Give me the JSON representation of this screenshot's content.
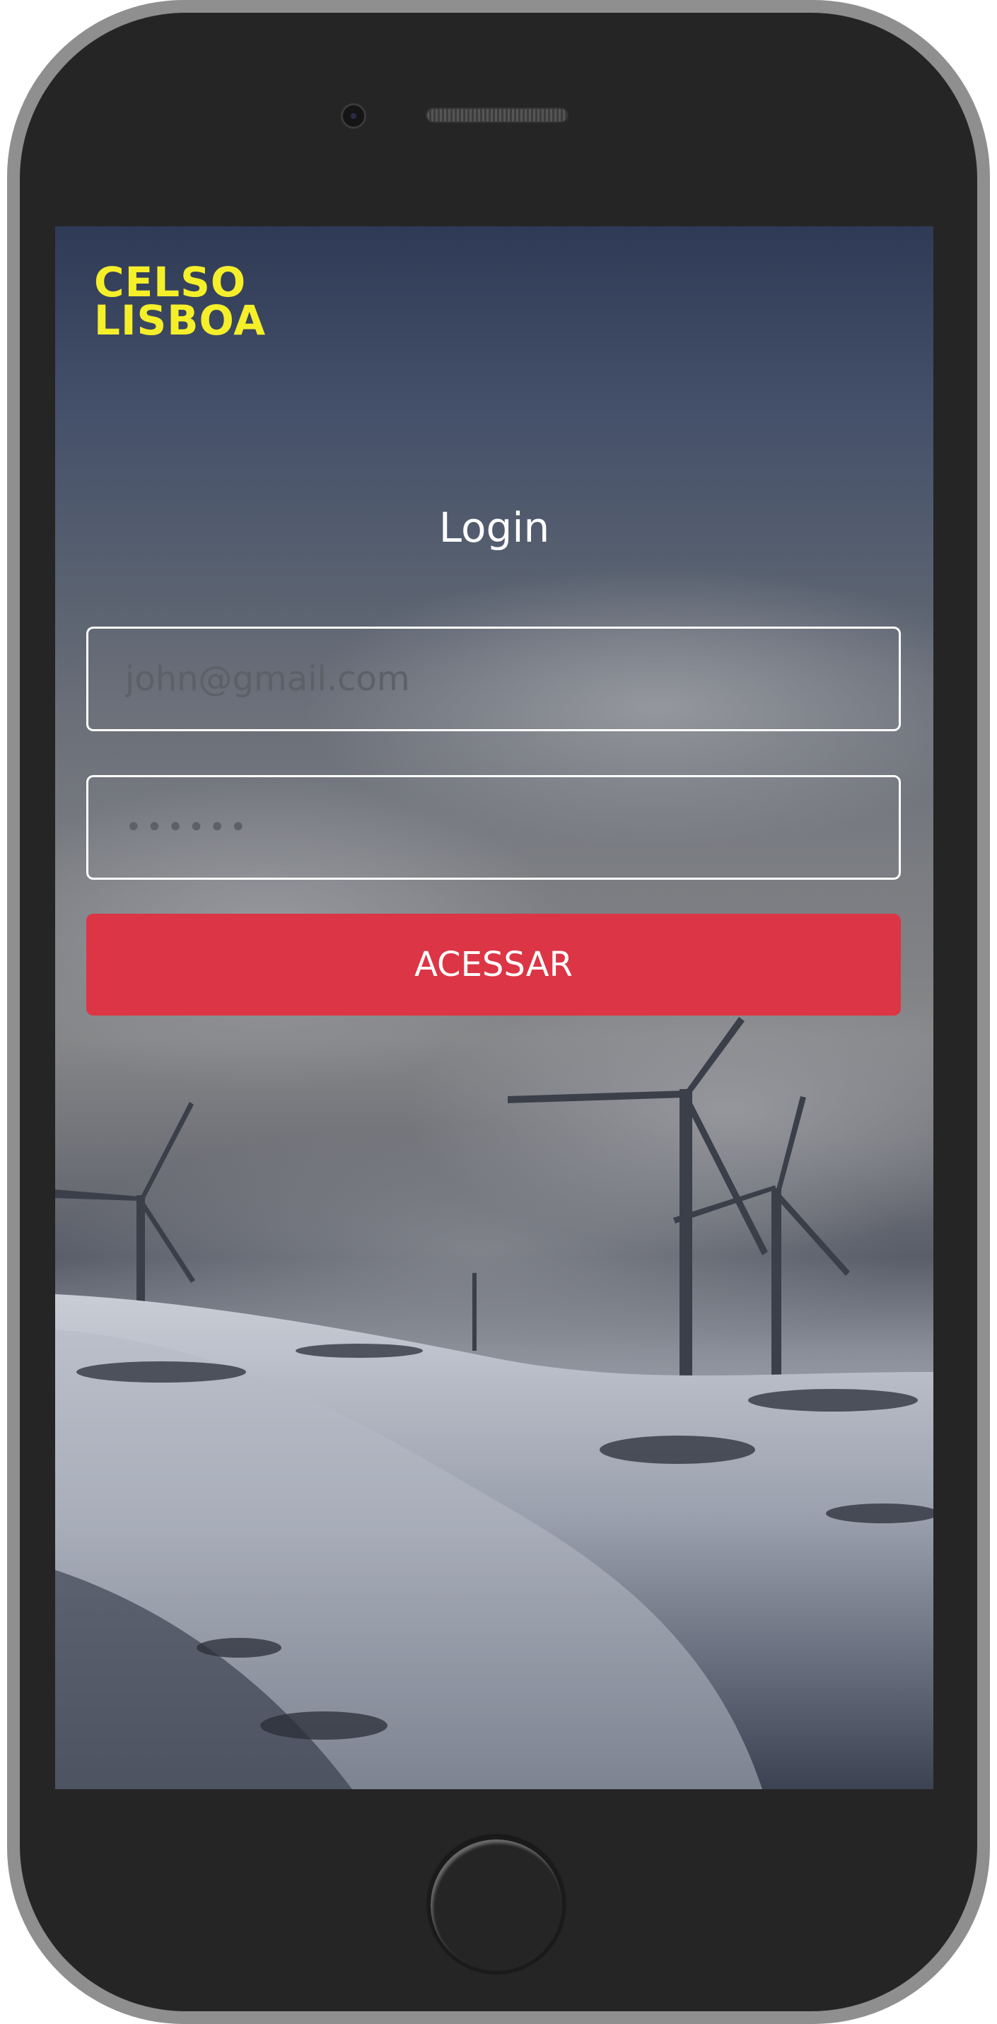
{
  "app": {
    "logo_line1": "CELSO",
    "logo_line2": "LISBOA",
    "logo_color": "#f5ef2a"
  },
  "login": {
    "title": "Login",
    "email_placeholder": "john@gmail.com",
    "password_value": "••••••",
    "submit_label": "ACESSAR",
    "submit_color": "#dc3545"
  }
}
